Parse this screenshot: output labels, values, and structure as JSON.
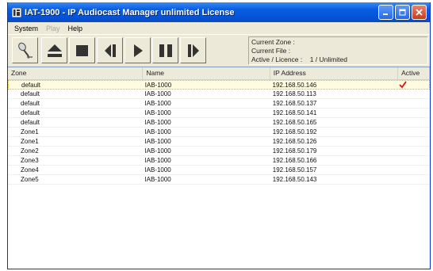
{
  "window": {
    "title": "IAT-1900 - IP Audiocast Manager unlimited License"
  },
  "menu": [
    {
      "label": "System",
      "disabled": false
    },
    {
      "label": "Play",
      "disabled": true
    },
    {
      "label": "Help",
      "disabled": false
    }
  ],
  "toolbar": {
    "buttons": [
      "microphone-icon",
      "eject-icon",
      "stop-icon",
      "previous-icon",
      "play-icon",
      "pause-icon",
      "next-icon"
    ]
  },
  "status": {
    "current_zone": "Current Zone :",
    "current_file": "Current File :",
    "active_licence_label": "Active / Licence :",
    "active_licence_value": "1 / Unlimited"
  },
  "table": {
    "columns": [
      "Zone",
      "Name",
      "IP Address",
      "Active"
    ],
    "rows": [
      {
        "zone": "default",
        "name": "IAB-1000",
        "ip": "192.168.50.146",
        "active": true
      },
      {
        "zone": "default",
        "name": "IAB-1000",
        "ip": "192.168.50.113",
        "active": false
      },
      {
        "zone": "default",
        "name": "IAB-1000",
        "ip": "192.168.50.137",
        "active": false
      },
      {
        "zone": "default",
        "name": "IAB-1000",
        "ip": "192.168.50.141",
        "active": false
      },
      {
        "zone": "default",
        "name": "IAB-1000",
        "ip": "192.168.50.165",
        "active": false
      },
      {
        "zone": "Zone1",
        "name": "IAB-1000",
        "ip": "192.168.50.192",
        "active": false
      },
      {
        "zone": "Zone1",
        "name": "IAB-1000",
        "ip": "192.168.50.126",
        "active": false
      },
      {
        "zone": "Zone2",
        "name": "IAB-1000",
        "ip": "192.168.50.179",
        "active": false
      },
      {
        "zone": "Zone3",
        "name": "IAB-1000",
        "ip": "192.168.50.166",
        "active": false
      },
      {
        "zone": "Zone4",
        "name": "IAB-1000",
        "ip": "192.168.50.157",
        "active": false
      },
      {
        "zone": "Zone5",
        "name": "IAB-1000",
        "ip": "192.168.50.143",
        "active": false
      }
    ]
  },
  "colors": {
    "titlebar": "#0a5ee0",
    "selected_row": "#fffbe0",
    "active_check": "#e01010"
  }
}
